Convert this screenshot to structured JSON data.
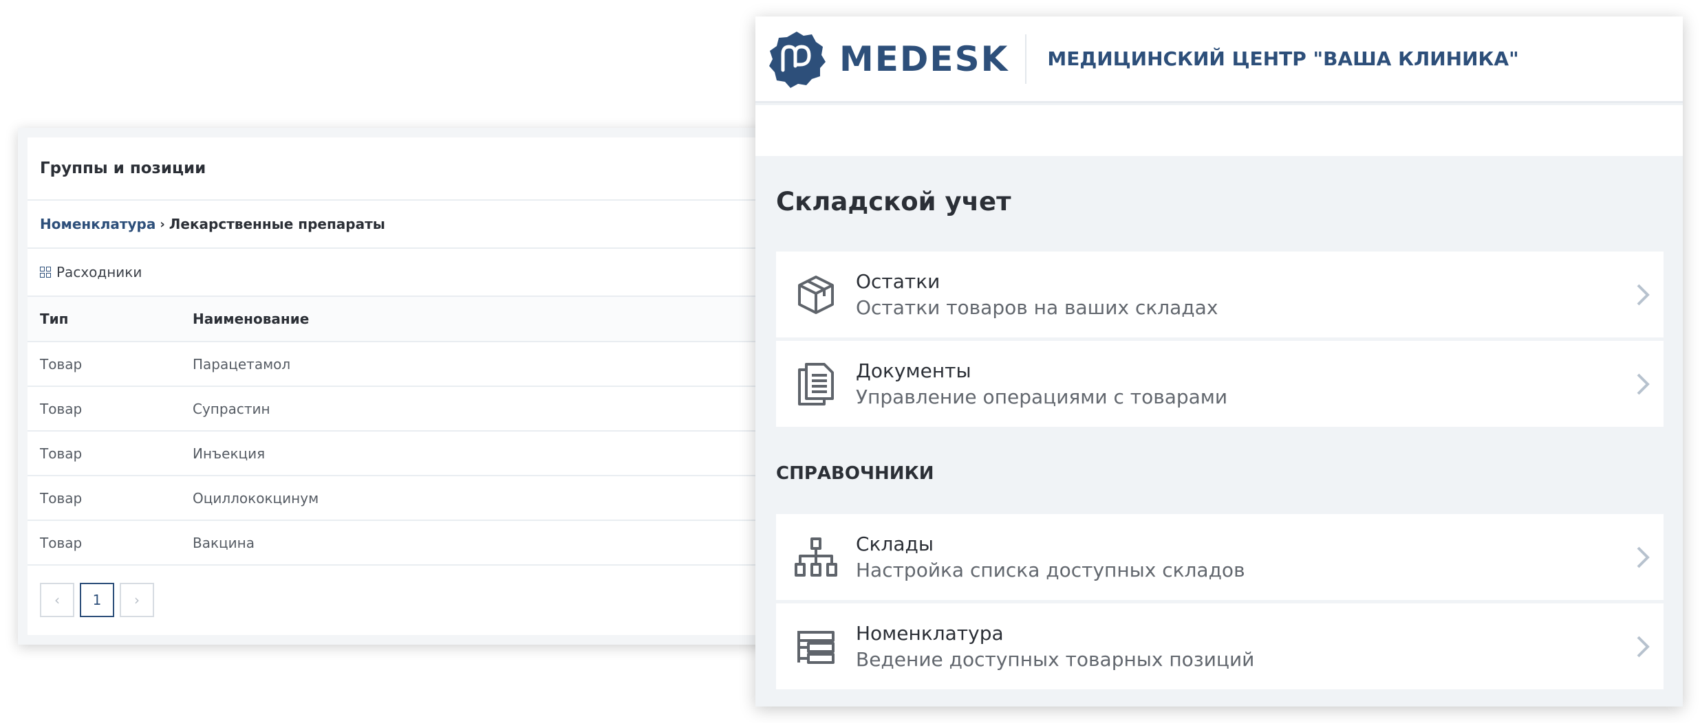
{
  "left_panel": {
    "title": "Группы и позиции",
    "breadcrumb": {
      "link": "Номенклатура",
      "separator": "›",
      "current": "Лекарственные препараты"
    },
    "group_label": "Расходники",
    "table": {
      "headers": [
        "Тип",
        "Наименование"
      ],
      "rows": [
        {
          "type": "Товар",
          "name": "Парацетамол"
        },
        {
          "type": "Товар",
          "name": "Супрастин"
        },
        {
          "type": "Товар",
          "name": "Инъекция"
        },
        {
          "type": "Товар",
          "name": "Оциллококцинум"
        },
        {
          "type": "Товар",
          "name": "Вакцина"
        }
      ]
    },
    "pagination": {
      "prev": "‹",
      "page": "1",
      "next": "›"
    }
  },
  "right_panel": {
    "brand": "MEDESK",
    "clinic_name": "МЕДИЦИНСКИЙ ЦЕНТР \"ВАША КЛИНИКА\"",
    "section_title": "Складской учет",
    "items": [
      {
        "title": "Остатки",
        "desc": "Остатки товаров на ваших складах",
        "icon": "box-icon"
      },
      {
        "title": "Документы",
        "desc": "Управление операциями с товарами",
        "icon": "documents-icon"
      }
    ],
    "reference_title": "СПРАВОЧНИКИ",
    "reference_items": [
      {
        "title": "Склады",
        "desc": "Настройка списка доступных складов",
        "icon": "hierarchy-icon"
      },
      {
        "title": "Номенклатура",
        "desc": "Ведение доступных товарных позиций",
        "icon": "nomenclature-icon"
      }
    ]
  },
  "colors": {
    "brand": "#2d4f7a",
    "background": "#f0f3f6",
    "text": "#2b2f36",
    "muted": "#62676e"
  }
}
